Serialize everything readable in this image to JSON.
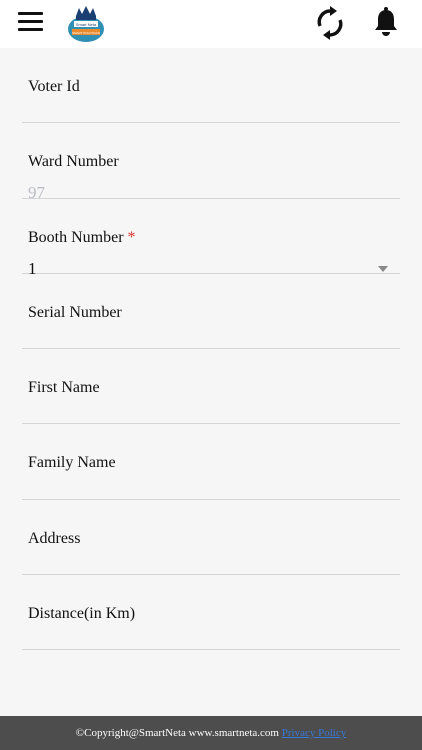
{
  "header": {
    "logo_top_text": "Smart Neta",
    "logo_band_text": "SMART POLITICIAN"
  },
  "form": {
    "fields": [
      {
        "label": "Voter Id",
        "value": ""
      },
      {
        "label": "Ward Number",
        "value": "97"
      },
      {
        "label": "Booth Number",
        "required_mark": "*",
        "value": "1"
      },
      {
        "label": "Serial Number",
        "value": ""
      },
      {
        "label": "First Name",
        "value": ""
      },
      {
        "label": "Family Name",
        "value": ""
      },
      {
        "label": "Address",
        "value": ""
      },
      {
        "label": "Distance(in Km)",
        "value": ""
      }
    ]
  },
  "footer": {
    "copyright": "©Copyright@SmartNeta www.smartneta.com ",
    "privacy_link": "Privacy Policy"
  },
  "colors": {
    "required": "#d9342b",
    "footer_bg": "#4d4d4d",
    "link": "#3a78d8"
  }
}
